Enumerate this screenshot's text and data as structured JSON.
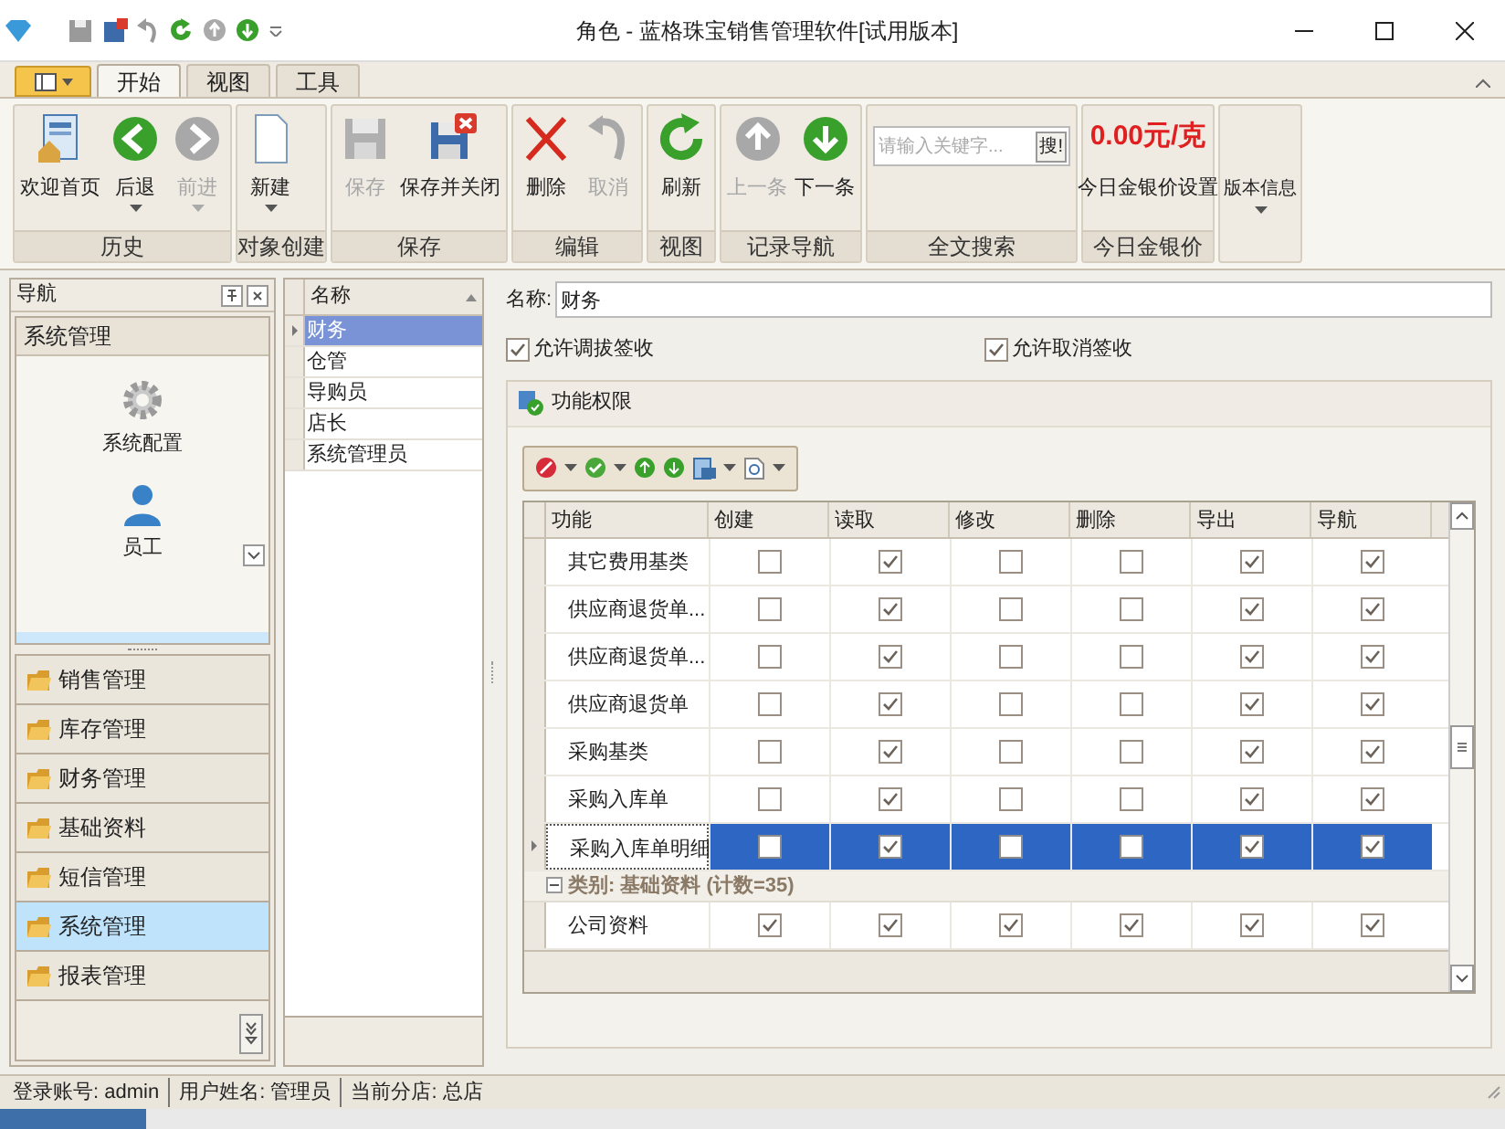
{
  "window": {
    "title": "角色 - 蓝格珠宝销售管理软件[试用版本]"
  },
  "tabs": [
    {
      "label": "开始",
      "selected": true
    },
    {
      "label": "视图",
      "selected": false
    },
    {
      "label": "工具",
      "selected": false
    }
  ],
  "ribbon": [
    {
      "label": "历史",
      "buttons": [
        {
          "label": "欢迎首页",
          "kind": "home",
          "disabled": false,
          "dropdown": false
        },
        {
          "label": "后退",
          "kind": "back",
          "disabled": false,
          "dropdown": true
        },
        {
          "label": "前进",
          "kind": "forward",
          "disabled": true,
          "dropdown": true
        }
      ]
    },
    {
      "label": "对象创建",
      "buttons": [
        {
          "label": "新建",
          "kind": "new",
          "disabled": false,
          "dropdown": true
        }
      ]
    },
    {
      "label": "保存",
      "buttons": [
        {
          "label": "保存",
          "kind": "save",
          "disabled": true,
          "dropdown": false
        },
        {
          "label": "保存并关闭",
          "kind": "save-close",
          "disabled": false,
          "dropdown": false
        }
      ]
    },
    {
      "label": "编辑",
      "buttons": [
        {
          "label": "删除",
          "kind": "delete",
          "disabled": false,
          "dropdown": false
        },
        {
          "label": "取消",
          "kind": "undo",
          "disabled": true,
          "dropdown": false
        }
      ]
    },
    {
      "label": "视图",
      "buttons": [
        {
          "label": "刷新",
          "kind": "refresh",
          "disabled": false,
          "dropdown": false
        }
      ]
    },
    {
      "label": "记录导航",
      "buttons": [
        {
          "label": "上一条",
          "kind": "up",
          "disabled": true,
          "dropdown": false
        },
        {
          "label": "下一条",
          "kind": "down",
          "disabled": false,
          "dropdown": false
        }
      ]
    }
  ],
  "search": {
    "placeholder": "请输入关键字...",
    "button": "搜!",
    "group": "全文搜索"
  },
  "gold_price": {
    "price": "0.00元/克",
    "button": "今日金银价设置",
    "group": "今日金银价"
  },
  "version": {
    "label": "版本信息"
  },
  "navigation": {
    "title": "导航",
    "group": "系统管理",
    "items": [
      {
        "label": "系统配置",
        "kind": "gear"
      },
      {
        "label": "员工",
        "kind": "person"
      }
    ],
    "bars": [
      {
        "label": "销售管理",
        "selected": false
      },
      {
        "label": "库存管理",
        "selected": false
      },
      {
        "label": "财务管理",
        "selected": false
      },
      {
        "label": "基础资料",
        "selected": false
      },
      {
        "label": "短信管理",
        "selected": false
      },
      {
        "label": "系统管理",
        "selected": true
      },
      {
        "label": "报表管理",
        "selected": false
      }
    ]
  },
  "role_list": {
    "column": "名称",
    "rows": [
      {
        "name": "财务",
        "selected": true
      },
      {
        "name": "仓管",
        "selected": false
      },
      {
        "name": "导购员",
        "selected": false
      },
      {
        "name": "店长",
        "selected": false
      },
      {
        "name": "系统管理员",
        "selected": false
      }
    ]
  },
  "detail": {
    "name_label": "名称:",
    "name_value": "财务",
    "options": [
      {
        "label": "允许调拔签收",
        "checked": true
      },
      {
        "label": "允许取消签收",
        "checked": true
      }
    ],
    "section": "功能权限",
    "columns": [
      "功能",
      "创建",
      "读取",
      "修改",
      "删除",
      "导出",
      "导航"
    ],
    "rows": [
      {
        "kind": "row",
        "name": "其它费用基类",
        "selected": false,
        "checks": [
          false,
          true,
          false,
          false,
          true,
          true
        ]
      },
      {
        "kind": "row",
        "name": "供应商退货单...",
        "selected": false,
        "checks": [
          false,
          true,
          false,
          false,
          true,
          true
        ]
      },
      {
        "kind": "row",
        "name": "供应商退货单...",
        "selected": false,
        "checks": [
          false,
          true,
          false,
          false,
          true,
          true
        ]
      },
      {
        "kind": "row",
        "name": "供应商退货单",
        "selected": false,
        "checks": [
          false,
          true,
          false,
          false,
          true,
          true
        ]
      },
      {
        "kind": "row",
        "name": "采购基类",
        "selected": false,
        "checks": [
          false,
          true,
          false,
          false,
          true,
          true
        ]
      },
      {
        "kind": "row",
        "name": "采购入库单",
        "selected": false,
        "checks": [
          false,
          true,
          false,
          false,
          true,
          true
        ]
      },
      {
        "kind": "row",
        "name": "采购入库单明细",
        "selected": true,
        "checks": [
          false,
          true,
          false,
          false,
          true,
          true
        ]
      },
      {
        "kind": "group",
        "name": "类别: 基础资料 (计数=35)",
        "expanded": true
      },
      {
        "kind": "row",
        "name": "公司资料",
        "selected": false,
        "checks": [
          true,
          true,
          true,
          true,
          true,
          true
        ]
      }
    ]
  },
  "status_bar": [
    "登录账号: admin",
    "用户姓名: 管理员",
    "当前分店: 总店"
  ]
}
